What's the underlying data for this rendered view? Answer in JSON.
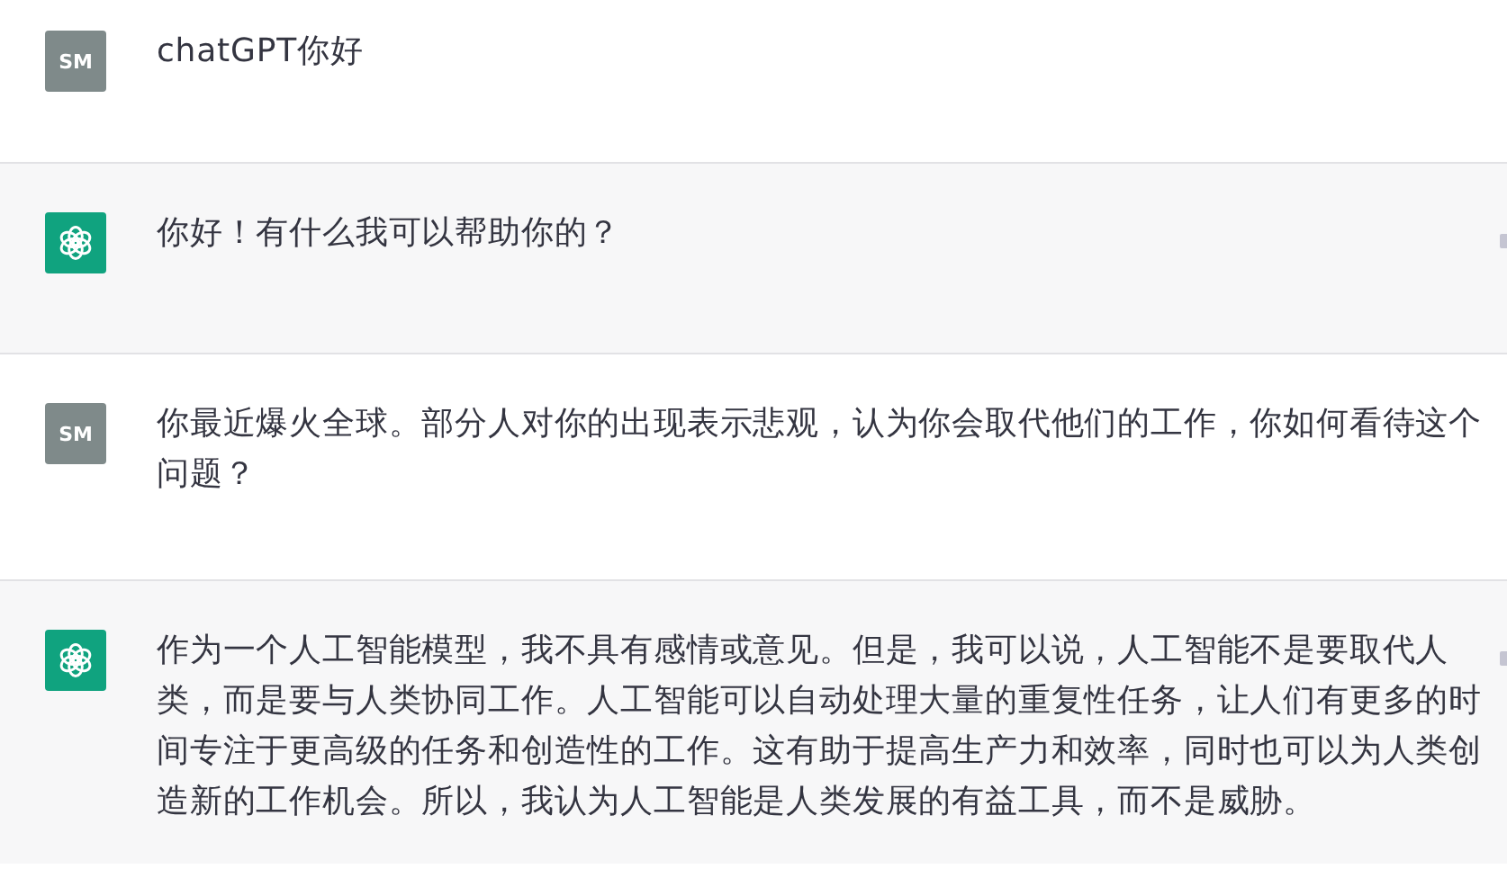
{
  "messages": [
    {
      "kind": "user",
      "avatar": "SM",
      "text": "chatGPT你好"
    },
    {
      "kind": "assistant",
      "text": "你好！有什么我可以帮助你的？"
    },
    {
      "kind": "user",
      "avatar": "SM",
      "text": "你最近爆火全球。部分人对你的出现表示悲观，认为你会取代他们的工作，你如何看待这个问题？"
    },
    {
      "kind": "assistant",
      "text": "作为一个人工智能模型，我不具有感情或意见。但是，我可以说，人工智能不是要取代人类，而是要与人类协同工作。人工智能可以自动处理大量的重复性任务，让人们有更多的时间专注于更高级的任务和创造性的工作。这有助于提高生产力和效率，同时也可以为人类创造新的工作机会。所以，我认为人工智能是人类发展的有益工具，而不是威胁。"
    }
  ]
}
